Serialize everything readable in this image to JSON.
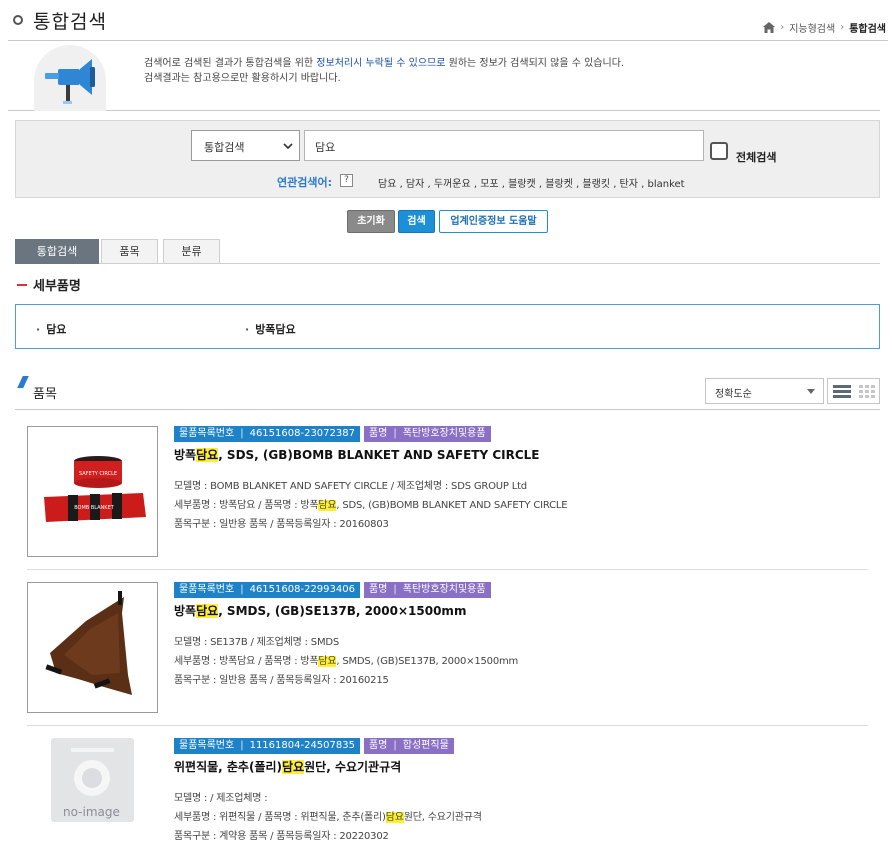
{
  "header": {
    "title": "통합검색",
    "breadcrumb": {
      "middle": "지능형검색",
      "current": "통합검색"
    }
  },
  "notice": {
    "line1_pre": "검색어로 검색된 결과가 통합검색을 위한 ",
    "line1_highlight": "정보처리시 누락될 수 있으므로",
    "line1_post": " 원하는 정보가 검색되지 않을 수 있습니다.",
    "line2": "검색결과는 참고용으로만 활용하시기 바랍니다."
  },
  "search": {
    "scope_selected": "통합검색",
    "query": "담요",
    "full_search_label": "전체검색",
    "related_label": "연관검색어:",
    "related_help": "?",
    "related_terms": "담요 , 담자 , 두꺼운요 , 모포 , 블랑캣 , 블랑켓 , 블랭킷 , 탄자 , blanket"
  },
  "buttons": {
    "reset": "초기화",
    "search": "검색",
    "help": "업계인증정보 도움말"
  },
  "tabs": [
    {
      "label": "통합검색",
      "active": true
    },
    {
      "label": "품목",
      "active": false
    },
    {
      "label": "분류",
      "active": false
    }
  ],
  "detail": {
    "heading": "세부품명",
    "items": [
      "담요",
      "방폭담요"
    ]
  },
  "products_section": {
    "heading": "품목",
    "sort_selected": "정확도순"
  },
  "products": [
    {
      "badge_catalog_label": "물품목록번호",
      "badge_catalog_value": "46151608-23072387",
      "badge_name_label": "품명",
      "badge_name_value": "폭탄방호장치및용품",
      "title_pre": "방폭",
      "title_hl": "담요",
      "title_post": ", SDS, (GB)BOMB BLANKET AND SAFETY CIRCLE",
      "model": "모델명 : BOMB BLANKET AND SAFETY CIRCLE / 제조업체명 : SDS GROUP Ltd",
      "detail_pre": "세부품명 : 방폭담요 / 품목명 : 방폭",
      "detail_hl": "담요",
      "detail_post": ", SDS, (GB)BOMB BLANKET AND SAFETY CIRCLE",
      "class": "품목구분 : 일반용 품목 / 품목등록일자 : 20160803"
    },
    {
      "badge_catalog_label": "물품목록번호",
      "badge_catalog_value": "46151608-22993406",
      "badge_name_label": "품명",
      "badge_name_value": "폭탄방호장치및용품",
      "title_pre": "방폭",
      "title_hl": "담요",
      "title_post": ", SMDS, (GB)SE137B, 2000×1500mm",
      "model": "모델명 : SE137B / 제조업체명 : SMDS",
      "detail_pre": "세부품명 : 방폭담요 / 품목명 : 방폭",
      "detail_hl": "담요",
      "detail_post": ", SMDS, (GB)SE137B, 2000×1500mm",
      "class": "품목구분 : 일반용 품목 / 품목등록일자 : 20160215"
    },
    {
      "badge_catalog_label": "물품목록번호",
      "badge_catalog_value": "11161804-24507835",
      "badge_name_label": "품명",
      "badge_name_value": "합성편직물",
      "title_pre": "위편직물, 춘추(폴리)",
      "title_hl": "담요",
      "title_post": "원단, 수요기관규격",
      "model": "모델명 : / 제조업체명 :",
      "detail_pre": "세부품명 : 위편직물 / 품목명 : 위편직물, 춘추(폴리)",
      "detail_hl": "담요",
      "detail_post": "원단, 수요기관규격",
      "class": "품목구분 : 계약용 품목 / 품목등록일자 : 20220302",
      "noimage_text": "no-image"
    }
  ],
  "colors": {
    "accent_blue": "#1e82c8",
    "badge_purple": "#8a70c4",
    "highlight": "#ffef2e",
    "tab_active": "#6b7580"
  }
}
